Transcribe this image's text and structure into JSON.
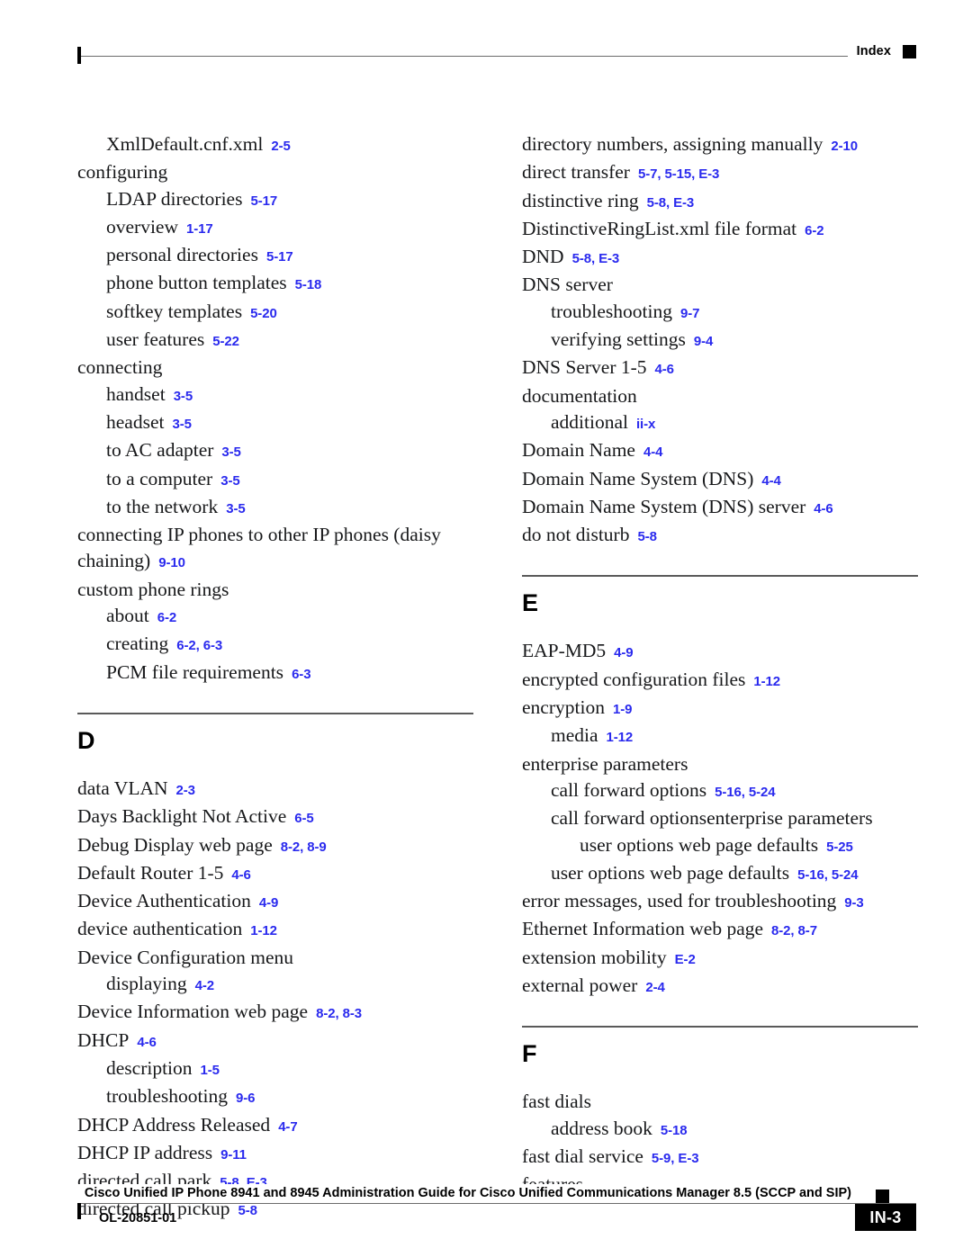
{
  "header": {
    "label": "Index",
    "marker_icon": "black-square-marker"
  },
  "colors": {
    "page_reference": "#2a2aee",
    "text": "#17181a",
    "rule": "#6b6b6b"
  },
  "columns": {
    "left": [
      {
        "type": "entry",
        "level": 1,
        "term": "XmlDefault.cnf.xml",
        "ref": "2-5"
      },
      {
        "type": "entry",
        "level": 0,
        "term": "configuring",
        "ref": ""
      },
      {
        "type": "entry",
        "level": 1,
        "term": "LDAP directories",
        "ref": "5-17"
      },
      {
        "type": "entry",
        "level": 1,
        "term": "overview",
        "ref": "1-17"
      },
      {
        "type": "entry",
        "level": 1,
        "term": "personal directories",
        "ref": "5-17"
      },
      {
        "type": "entry",
        "level": 1,
        "term": "phone button templates",
        "ref": "5-18"
      },
      {
        "type": "entry",
        "level": 1,
        "term": "softkey templates",
        "ref": "5-20"
      },
      {
        "type": "entry",
        "level": 1,
        "term": "user features",
        "ref": "5-22"
      },
      {
        "type": "entry",
        "level": 0,
        "term": "connecting",
        "ref": ""
      },
      {
        "type": "entry",
        "level": 1,
        "term": "handset",
        "ref": "3-5"
      },
      {
        "type": "entry",
        "level": 1,
        "term": "headset",
        "ref": "3-5"
      },
      {
        "type": "entry",
        "level": 1,
        "term": "to AC adapter",
        "ref": "3-5"
      },
      {
        "type": "entry",
        "level": 1,
        "term": "to a computer",
        "ref": "3-5"
      },
      {
        "type": "entry",
        "level": 1,
        "term": "to the network",
        "ref": "3-5"
      },
      {
        "type": "entry",
        "level": 0,
        "term": "connecting IP phones to other IP phones (daisy chaining)",
        "ref": "9-10"
      },
      {
        "type": "entry",
        "level": 0,
        "term": "custom phone rings",
        "ref": ""
      },
      {
        "type": "entry",
        "level": 1,
        "term": "about",
        "ref": "6-2"
      },
      {
        "type": "entry",
        "level": 1,
        "term": "creating",
        "ref": "6-2, 6-3"
      },
      {
        "type": "entry",
        "level": 1,
        "term": "PCM file requirements",
        "ref": "6-3"
      },
      {
        "type": "section",
        "letter": "D"
      },
      {
        "type": "entry",
        "level": 0,
        "term": "data VLAN",
        "ref": "2-3"
      },
      {
        "type": "entry",
        "level": 0,
        "term": "Days Backlight Not Active",
        "ref": "6-5"
      },
      {
        "type": "entry",
        "level": 0,
        "term": "Debug Display web page",
        "ref": "8-2, 8-9"
      },
      {
        "type": "entry",
        "level": 0,
        "term": "Default Router 1-5",
        "ref": "4-6"
      },
      {
        "type": "entry",
        "level": 0,
        "term": "Device Authentication",
        "ref": "4-9"
      },
      {
        "type": "entry",
        "level": 0,
        "term": "device authentication",
        "ref": "1-12"
      },
      {
        "type": "entry",
        "level": 0,
        "term": "Device Configuration menu",
        "ref": ""
      },
      {
        "type": "entry",
        "level": 1,
        "term": "displaying",
        "ref": "4-2"
      },
      {
        "type": "entry",
        "level": 0,
        "term": "Device Information web page",
        "ref": "8-2, 8-3"
      },
      {
        "type": "entry",
        "level": 0,
        "term": "DHCP",
        "ref": "4-6"
      },
      {
        "type": "entry",
        "level": 1,
        "term": "description",
        "ref": "1-5"
      },
      {
        "type": "entry",
        "level": 1,
        "term": "troubleshooting",
        "ref": "9-6"
      },
      {
        "type": "entry",
        "level": 0,
        "term": "DHCP Address Released",
        "ref": "4-7"
      },
      {
        "type": "entry",
        "level": 0,
        "term": "DHCP IP address",
        "ref": "9-11"
      },
      {
        "type": "entry",
        "level": 0,
        "term": "directed call park",
        "ref": "5-8, E-3"
      },
      {
        "type": "entry",
        "level": 0,
        "term": "directed call pickup",
        "ref": "5-8"
      }
    ],
    "right": [
      {
        "type": "entry",
        "level": 0,
        "term": "directory numbers, assigning manually",
        "ref": "2-10"
      },
      {
        "type": "entry",
        "level": 0,
        "term": "direct transfer",
        "ref": "5-7, 5-15, E-3"
      },
      {
        "type": "entry",
        "level": 0,
        "term": "distinctive ring",
        "ref": "5-8, E-3"
      },
      {
        "type": "entry",
        "level": 0,
        "term": "DistinctiveRingList.xml file format",
        "ref": "6-2"
      },
      {
        "type": "entry",
        "level": 0,
        "term": "DND",
        "ref": "5-8, E-3"
      },
      {
        "type": "entry",
        "level": 0,
        "term": "DNS server",
        "ref": ""
      },
      {
        "type": "entry",
        "level": 1,
        "term": "troubleshooting",
        "ref": "9-7"
      },
      {
        "type": "entry",
        "level": 1,
        "term": "verifying settings",
        "ref": "9-4"
      },
      {
        "type": "entry",
        "level": 0,
        "term": "DNS Server 1-5",
        "ref": "4-6"
      },
      {
        "type": "entry",
        "level": 0,
        "term": "documentation",
        "ref": ""
      },
      {
        "type": "entry",
        "level": 1,
        "term": "additional",
        "ref": "ii-x"
      },
      {
        "type": "entry",
        "level": 0,
        "term": "Domain Name",
        "ref": "4-4"
      },
      {
        "type": "entry",
        "level": 0,
        "term": "Domain Name System (DNS)",
        "ref": "4-4"
      },
      {
        "type": "entry",
        "level": 0,
        "term": "Domain Name System (DNS) server",
        "ref": "4-6"
      },
      {
        "type": "entry",
        "level": 0,
        "term": "do not disturb",
        "ref": "5-8"
      },
      {
        "type": "section",
        "letter": "E"
      },
      {
        "type": "entry",
        "level": 0,
        "term": "EAP-MD5",
        "ref": "4-9"
      },
      {
        "type": "entry",
        "level": 0,
        "term": "encrypted configuration files",
        "ref": "1-12"
      },
      {
        "type": "entry",
        "level": 0,
        "term": "encryption",
        "ref": "1-9"
      },
      {
        "type": "entry",
        "level": 1,
        "term": "media",
        "ref": "1-12"
      },
      {
        "type": "entry",
        "level": 0,
        "term": "enterprise parameters",
        "ref": ""
      },
      {
        "type": "entry",
        "level": 1,
        "term": "call forward options",
        "ref": "5-16, 5-24"
      },
      {
        "type": "entry",
        "level": 1,
        "term": "call forward optionsenterprise parameters",
        "ref": ""
      },
      {
        "type": "entry",
        "level": 2,
        "term": "user options web page defaults",
        "ref": "5-25"
      },
      {
        "type": "entry",
        "level": 1,
        "term": "user options web page defaults",
        "ref": "5-16, 5-24"
      },
      {
        "type": "entry",
        "level": 0,
        "term": "error messages, used for troubleshooting",
        "ref": "9-3"
      },
      {
        "type": "entry",
        "level": 0,
        "term": "Ethernet Information web page",
        "ref": "8-2, 8-7"
      },
      {
        "type": "entry",
        "level": 0,
        "term": "extension mobility",
        "ref": "E-2"
      },
      {
        "type": "entry",
        "level": 0,
        "term": "external power",
        "ref": "2-4"
      },
      {
        "type": "section",
        "letter": "F"
      },
      {
        "type": "entry",
        "level": 0,
        "term": "fast dials",
        "ref": ""
      },
      {
        "type": "entry",
        "level": 1,
        "term": "address book",
        "ref": "5-18"
      },
      {
        "type": "entry",
        "level": 0,
        "term": "fast dial service",
        "ref": "5-9, E-3"
      },
      {
        "type": "entry",
        "level": 0,
        "term": "features",
        "ref": ""
      }
    ]
  },
  "footer": {
    "doc_id": "OL-20851-01",
    "title": "Cisco Unified IP Phone 8941 and 8945 Administration Guide for Cisco Unified Communications Manager 8.5 (SCCP and SIP)",
    "page_number": "IN-3",
    "marker_icon": "black-square-marker"
  }
}
